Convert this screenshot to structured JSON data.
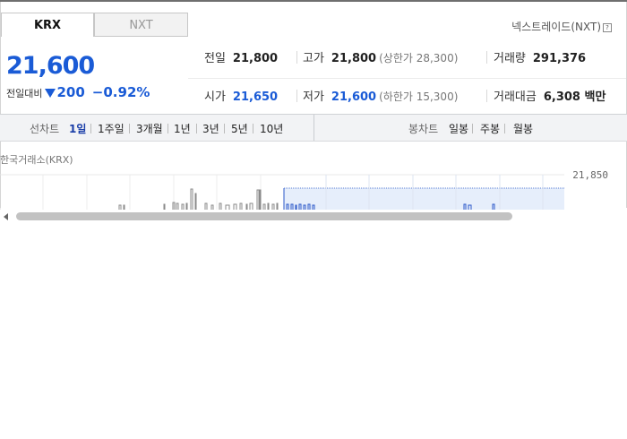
{
  "tabs": [
    {
      "label": "KRX",
      "active": true
    },
    {
      "label": "NXT",
      "active": false
    }
  ],
  "nxt_link": {
    "label": "넥스트레이드(NXT)",
    "help_icon": "?"
  },
  "quote": {
    "price": "21,600",
    "change_label": "전일대비",
    "change_direction": "down",
    "change_amount": "200",
    "change_percent": "−0.92%"
  },
  "info": {
    "prev_close": {
      "label": "전일",
      "value": "21,800"
    },
    "high": {
      "label": "고가",
      "value": "21,800",
      "sub": "(상한가 28,300)"
    },
    "volume": {
      "label": "거래량",
      "value": "291,376"
    },
    "open": {
      "label": "시가",
      "value": "21,650"
    },
    "low": {
      "label": "저가",
      "value": "21,600",
      "sub": "(하한가 15,300)"
    },
    "amount": {
      "label": "거래대금",
      "value": "6,308 백만"
    }
  },
  "period_bar": {
    "line_chart_label": "선차트",
    "line_periods": [
      "1일",
      "1주일",
      "3개월",
      "1년",
      "3년",
      "5년",
      "10년"
    ],
    "active_period": "1일",
    "candle_chart_label": "봉차트",
    "candle_periods": [
      "일봉",
      "주봉",
      "월봉"
    ]
  },
  "chart": {
    "exchange_label": "한국거래소(KRX)",
    "y_top_label": "21,850",
    "colors": {
      "line": "#8a8a8a",
      "accent": "#2c58c8",
      "fill": "#e6eefb",
      "grid": "#e8e8e8"
    }
  },
  "colors": {
    "down": "#1a5bd6",
    "active_tab_text": "#111111",
    "inactive_tab_text": "#999999"
  }
}
